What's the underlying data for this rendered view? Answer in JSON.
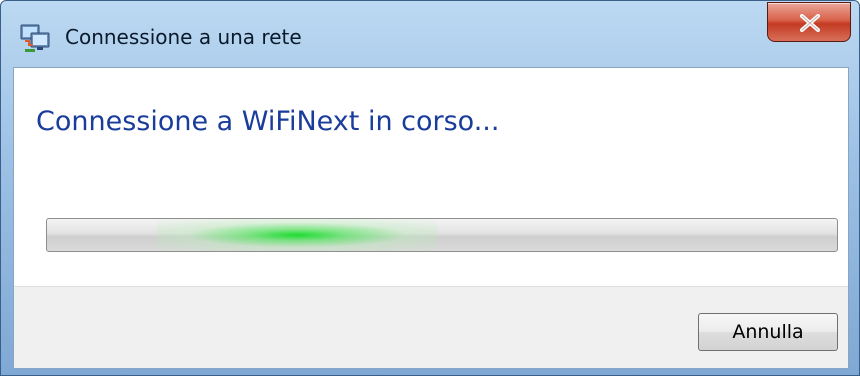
{
  "window": {
    "title": "Connessione a una rete",
    "icon": "network-connection-icon"
  },
  "main": {
    "heading": "Connessione a WiFiNext in corso...",
    "progress": {
      "mode": "indeterminate",
      "glow_color": "#19d93a"
    }
  },
  "footer": {
    "cancel_label": "Annulla"
  },
  "colors": {
    "heading": "#1a3c9a",
    "frame": "#9ec2e6",
    "close_button": "#c43a22",
    "footer_bg": "#f0f0f0"
  }
}
